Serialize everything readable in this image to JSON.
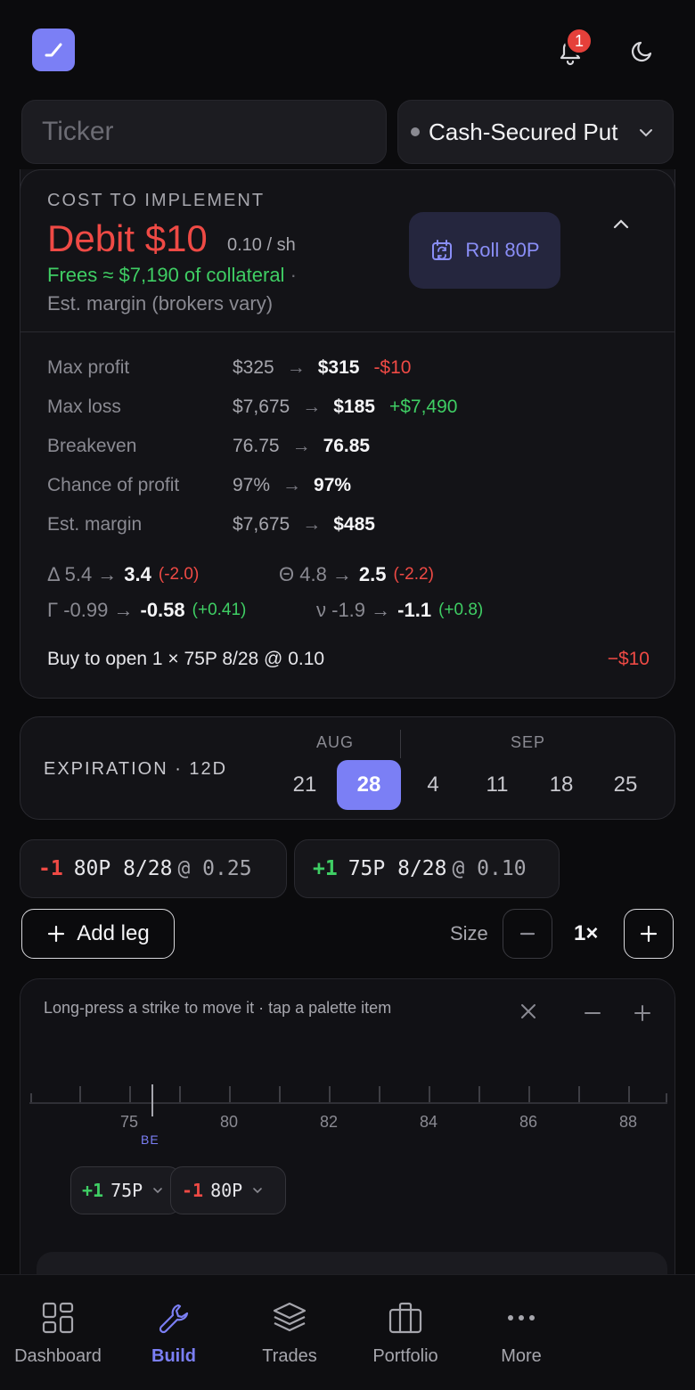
{
  "header": {
    "notifications_count": "1",
    "ticker_placeholder": "Ticker",
    "strategy": "Cash-Secured Put"
  },
  "cost": {
    "label": "COST TO IMPLEMENT",
    "debit": "Debit $10",
    "per_share": "0.10 / sh",
    "frees": "Frees ≈ $7,190 of collateral",
    "frees_sep": "·",
    "margin_note": "Est. margin (brokers vary)",
    "roll_label": "Roll 80P",
    "metrics": [
      {
        "label": "Max profit",
        "old": "$325",
        "new": "$315",
        "delta": "-$10",
        "delta_sign": "neg"
      },
      {
        "label": "Max loss",
        "old": "$7,675",
        "new": "$185",
        "delta": "+$7,490",
        "delta_sign": "pos"
      },
      {
        "label": "Breakeven",
        "old": "76.75",
        "new": "76.85",
        "delta": "",
        "delta_sign": ""
      },
      {
        "label": "Chance of profit",
        "old": "97%",
        "new": "97%",
        "delta": "",
        "delta_sign": ""
      },
      {
        "label": "Est. margin",
        "old": "$7,675",
        "new": "$485",
        "delta": "",
        "delta_sign": ""
      }
    ],
    "greeks": {
      "delta": {
        "old": "Δ 5.4 →",
        "new": "3.4",
        "chg": "(-2.0)"
      },
      "theta": {
        "old": "Θ 4.8 →",
        "new": "2.5",
        "chg": "(-2.2)"
      },
      "gamma": {
        "old": "Γ -0.99 →",
        "new": "-0.58",
        "chg": "(+0.41)"
      },
      "vega": {
        "old": "ν -1.9 →",
        "new": "-1.1",
        "chg": "(+0.8)"
      }
    },
    "order_line": "Buy to open 1 × 75P 8/28 @ 0.10",
    "order_amount": "−$10"
  },
  "expiration": {
    "label": "EXPIRATION · 12D",
    "months": [
      "AUG",
      "SEP"
    ],
    "days": [
      "21",
      "28",
      "4",
      "11",
      "18",
      "25"
    ],
    "selected": "28"
  },
  "legs": [
    {
      "qty": "-1",
      "desc": "80P 8/28",
      "price": "@ 0.25"
    },
    {
      "qty": "+1",
      "desc": "75P 8/28",
      "price": "@ 0.10"
    }
  ],
  "controls": {
    "add_leg": "Add leg",
    "size_label": "Size",
    "size_value": "1×"
  },
  "ladder": {
    "hint": "Long-press a strike to move it · tap a palette item",
    "ticks": [
      "75",
      "80",
      "82",
      "84",
      "86",
      "88"
    ],
    "be_label": "BE",
    "chips": [
      {
        "qty": "+1",
        "strike": "75P"
      },
      {
        "qty": "-1",
        "strike": "80P"
      }
    ]
  },
  "nav": [
    {
      "label": "Dashboard",
      "icon": "grid-icon"
    },
    {
      "label": "Build",
      "icon": "wrench-icon"
    },
    {
      "label": "Trades",
      "icon": "layers-icon"
    },
    {
      "label": "Portfolio",
      "icon": "briefcase-icon"
    },
    {
      "label": "More",
      "icon": "more-icon"
    }
  ],
  "nav_active": "Build",
  "colors": {
    "accent": "#7b7ff5",
    "negative": "#ef4a45",
    "positive": "#3fce64",
    "background": "#0b0b0d"
  }
}
